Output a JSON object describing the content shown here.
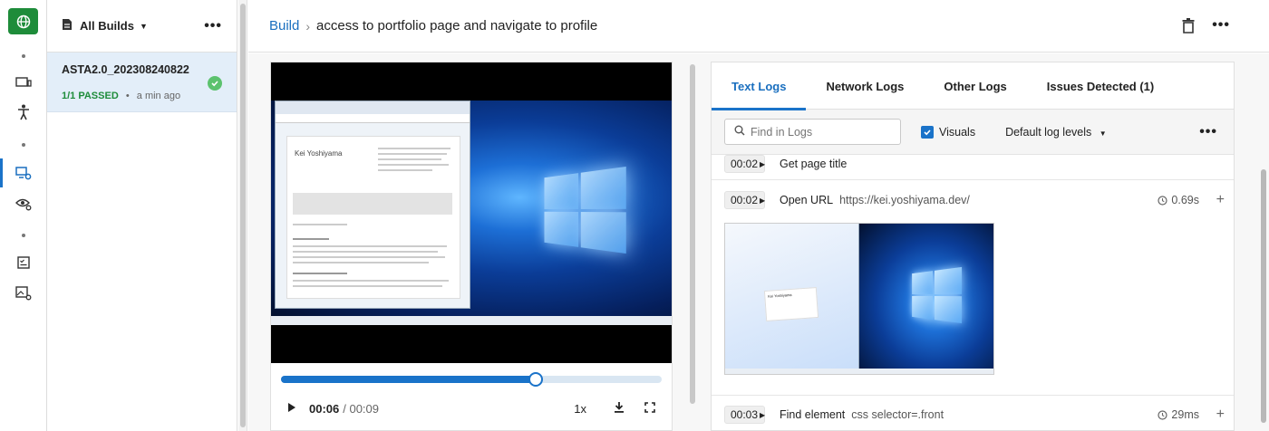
{
  "sidebar": {
    "header_label": "All Builds",
    "build": {
      "name": "ASTA2.0_202308240822",
      "status": "1/1 PASSED",
      "time": "a min ago"
    }
  },
  "breadcrumb": {
    "root": "Build",
    "title": "access to portfolio page and navigate to profile"
  },
  "player": {
    "current_time": "00:06",
    "duration": "/ 00:09",
    "progress": 0.67,
    "speed": "1x",
    "page_name": "Kei Yoshiyama"
  },
  "logs": {
    "tabs": [
      "Text Logs",
      "Network Logs",
      "Other Logs",
      "Issues Detected (1)"
    ],
    "search_placeholder": "Find in Logs",
    "visuals_label": "Visuals",
    "levels_label": "Default log levels",
    "rows": [
      {
        "time": "00:02",
        "action": "Get page title",
        "arg": "",
        "duration": ""
      },
      {
        "time": "00:02",
        "action": "Open URL",
        "arg": "https://kei.yoshiyama.dev/",
        "duration": "0.69s"
      },
      {
        "time": "00:03",
        "action": "Find element",
        "arg": "css selector=.front",
        "duration": "29ms"
      }
    ],
    "thumb_caption": "Kei Yoshiyama"
  },
  "colors": {
    "accent": "#1a73c9",
    "brand_green": "#1e8c3a",
    "passed": "#1e8c3a"
  }
}
